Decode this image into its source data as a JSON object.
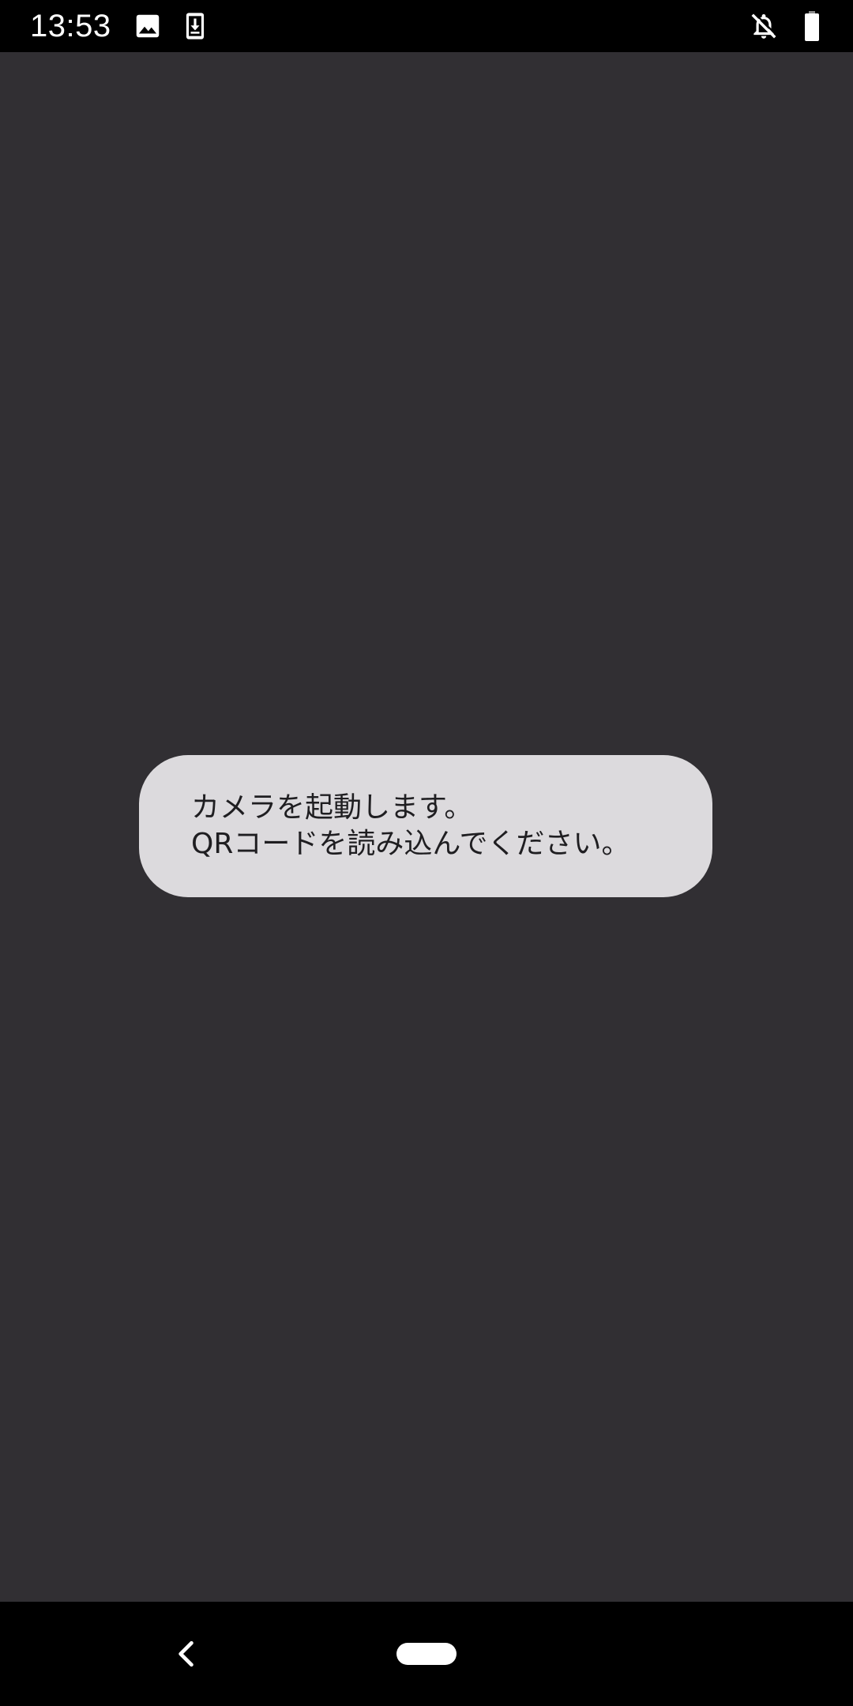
{
  "status_bar": {
    "time": "13:53",
    "icons": [
      "image-icon",
      "download-icon",
      "notifications-off-icon",
      "battery-icon"
    ]
  },
  "toast": {
    "line1": "カメラを起動します。",
    "line2": "QRコードを読み込んでください。"
  },
  "nav_bar": {
    "icons": [
      "back-icon",
      "home-pill-icon"
    ]
  },
  "colors": {
    "background": "#312f33",
    "toast_background": "#dcdadd",
    "toast_text": "#1f1e21",
    "bars": "#000000"
  }
}
